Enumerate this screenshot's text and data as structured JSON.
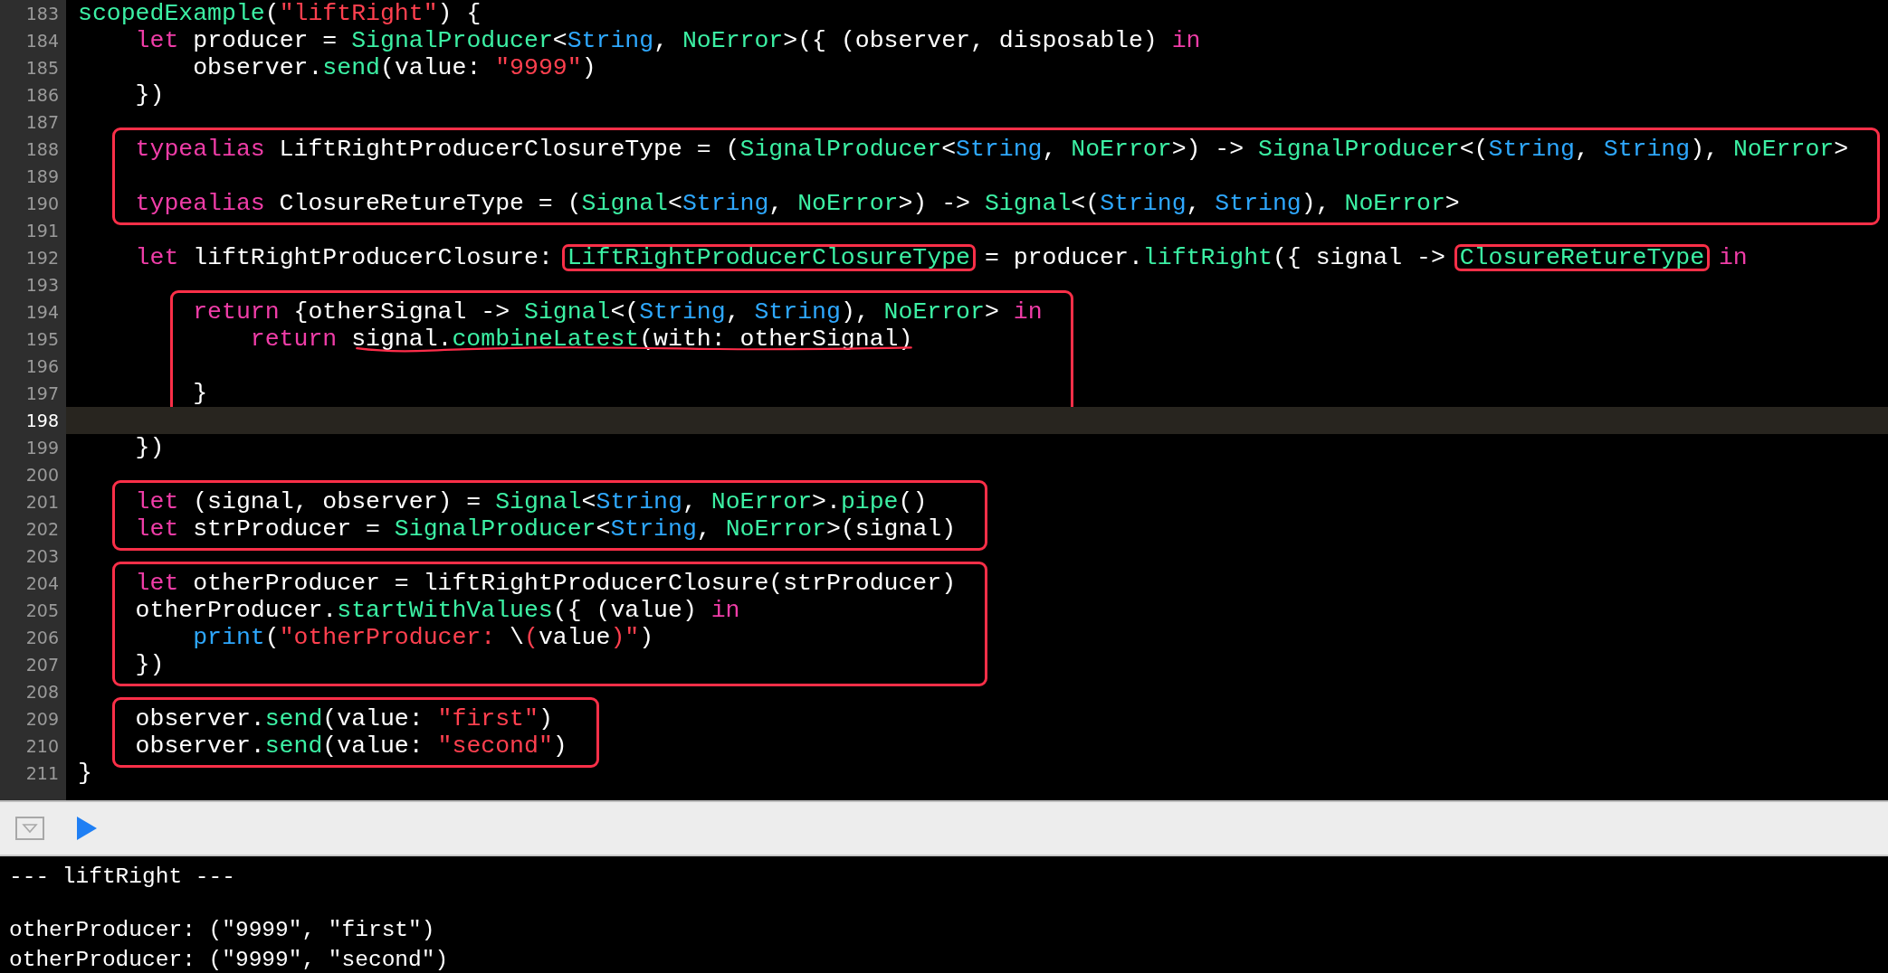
{
  "editor": {
    "blocks": [
      {
        "boxed": false,
        "lines": [
          {
            "n": "183",
            "current": false,
            "tokens": [
              {
                "text": "scopedExample",
                "kind": "type"
              },
              {
                "text": "(",
                "kind": "plain"
              },
              {
                "text": "\"liftRight\"",
                "kind": "string"
              },
              {
                "text": ") {",
                "kind": "plain"
              }
            ]
          },
          {
            "n": "184",
            "current": false,
            "tokens": [
              {
                "text": "    let",
                "kind": "keyword"
              },
              {
                "text": " producer = ",
                "kind": "plain"
              },
              {
                "text": "SignalProducer",
                "kind": "type"
              },
              {
                "text": "<",
                "kind": "plain"
              },
              {
                "text": "String",
                "kind": "builtin"
              },
              {
                "text": ", ",
                "kind": "plain"
              },
              {
                "text": "NoError",
                "kind": "type"
              },
              {
                "text": ">({ (observer, disposable) ",
                "kind": "plain"
              },
              {
                "text": "in",
                "kind": "keyword"
              }
            ]
          },
          {
            "n": "185",
            "current": false,
            "tokens": [
              {
                "text": "        observer.",
                "kind": "plain"
              },
              {
                "text": "send",
                "kind": "type"
              },
              {
                "text": "(value: ",
                "kind": "plain"
              },
              {
                "text": "\"9999\"",
                "kind": "string"
              },
              {
                "text": ")",
                "kind": "plain"
              }
            ]
          },
          {
            "n": "186",
            "current": false,
            "tokens": [
              {
                "text": "    })",
                "kind": "plain"
              }
            ]
          },
          {
            "n": "187",
            "current": false
          }
        ]
      },
      {
        "boxed": true,
        "lines": [
          {
            "n": "188",
            "current": false,
            "tokens": [
              {
                "text": "    typealias",
                "kind": "keyword"
              },
              {
                "text": " LiftRightProducerClosureType = (",
                "kind": "plain"
              },
              {
                "text": "SignalProducer",
                "kind": "type"
              },
              {
                "text": "<",
                "kind": "plain"
              },
              {
                "text": "String",
                "kind": "builtin"
              },
              {
                "text": ", ",
                "kind": "plain"
              },
              {
                "text": "NoError",
                "kind": "type"
              },
              {
                "text": ">) -> ",
                "kind": "plain"
              },
              {
                "text": "SignalProducer",
                "kind": "type"
              },
              {
                "text": "<(",
                "kind": "plain"
              },
              {
                "text": "String",
                "kind": "builtin"
              },
              {
                "text": ", ",
                "kind": "plain"
              },
              {
                "text": "String",
                "kind": "builtin"
              },
              {
                "text": "), ",
                "kind": "plain"
              },
              {
                "text": "NoError",
                "kind": "type"
              },
              {
                "text": ">",
                "kind": "plain"
              }
            ]
          },
          {
            "n": "189",
            "current": false
          },
          {
            "n": "190",
            "current": false,
            "tokens": [
              {
                "text": "    typealias",
                "kind": "keyword"
              },
              {
                "text": " ClosureRetureType = (",
                "kind": "plain"
              },
              {
                "text": "Signal",
                "kind": "type"
              },
              {
                "text": "<",
                "kind": "plain"
              },
              {
                "text": "String",
                "kind": "builtin"
              },
              {
                "text": ", ",
                "kind": "plain"
              },
              {
                "text": "NoError",
                "kind": "type"
              },
              {
                "text": ">) -> ",
                "kind": "plain"
              },
              {
                "text": "Signal",
                "kind": "type"
              },
              {
                "text": "<(",
                "kind": "plain"
              },
              {
                "text": "String",
                "kind": "builtin"
              },
              {
                "text": ", ",
                "kind": "plain"
              },
              {
                "text": "String",
                "kind": "builtin"
              },
              {
                "text": "), ",
                "kind": "plain"
              },
              {
                "text": "NoError",
                "kind": "type"
              },
              {
                "text": ">",
                "kind": "plain"
              }
            ]
          }
        ]
      },
      {
        "boxed": false,
        "lines": [
          {
            "n": "191",
            "current": false
          },
          {
            "n": "192",
            "current": false,
            "tokens": [
              {
                "text": "    let",
                "kind": "keyword"
              },
              {
                "text": " liftRightProducerClosure: ",
                "kind": "plain"
              },
              {
                "text": "LiftRightProducerClosureType",
                "kind": "type",
                "boxed": true
              },
              {
                "text": " = producer.",
                "kind": "plain"
              },
              {
                "text": "liftRight",
                "kind": "type"
              },
              {
                "text": "({ signal -> ",
                "kind": "plain"
              },
              {
                "text": "ClosureRetureType",
                "kind": "type",
                "boxed": true
              },
              {
                "text": " in",
                "kind": "keyword"
              }
            ]
          },
          {
            "n": "193",
            "current": false
          }
        ]
      },
      {
        "boxed": true,
        "lines": [
          {
            "n": "194",
            "current": false,
            "tokens": [
              {
                "text": "        return",
                "kind": "keyword"
              },
              {
                "text": " {otherSignal -> ",
                "kind": "plain"
              },
              {
                "text": "Signal",
                "kind": "type"
              },
              {
                "text": "<(",
                "kind": "plain"
              },
              {
                "text": "String",
                "kind": "builtin"
              },
              {
                "text": ", ",
                "kind": "plain"
              },
              {
                "text": "String",
                "kind": "builtin"
              },
              {
                "text": "), ",
                "kind": "plain"
              },
              {
                "text": "NoError",
                "kind": "type"
              },
              {
                "text": "> ",
                "kind": "plain"
              },
              {
                "text": "in",
                "kind": "keyword"
              }
            ]
          },
          {
            "n": "195",
            "current": false,
            "tokens": [
              {
                "text": "            return ",
                "kind": "keyword"
              },
              {
                "text": "signal.",
                "kind": "plain",
                "underlined": true
              },
              {
                "text": "combineLatest",
                "kind": "type",
                "underlined": true
              },
              {
                "text": "(with: otherSignal)",
                "kind": "plain",
                "underlined": true
              }
            ]
          },
          {
            "n": "196",
            "current": false
          },
          {
            "n": "197",
            "current": false,
            "tokens": [
              {
                "text": "        }",
                "kind": "plain"
              }
            ]
          }
        ]
      },
      {
        "boxed": false,
        "lines": [
          {
            "n": "198",
            "current": true
          },
          {
            "n": "199",
            "current": false,
            "tokens": [
              {
                "text": "    })",
                "kind": "plain"
              }
            ]
          },
          {
            "n": "200",
            "current": false
          }
        ]
      },
      {
        "boxed": true,
        "lines": [
          {
            "n": "201",
            "current": false,
            "tokens": [
              {
                "text": "    let",
                "kind": "keyword"
              },
              {
                "text": " (signal, observer) = ",
                "kind": "plain"
              },
              {
                "text": "Signal",
                "kind": "type"
              },
              {
                "text": "<",
                "kind": "plain"
              },
              {
                "text": "String",
                "kind": "builtin"
              },
              {
                "text": ", ",
                "kind": "plain"
              },
              {
                "text": "NoError",
                "kind": "type"
              },
              {
                "text": ">.",
                "kind": "plain"
              },
              {
                "text": "pipe",
                "kind": "type"
              },
              {
                "text": "()",
                "kind": "plain"
              }
            ]
          },
          {
            "n": "202",
            "current": false,
            "tokens": [
              {
                "text": "    let",
                "kind": "keyword"
              },
              {
                "text": " strProducer = ",
                "kind": "plain"
              },
              {
                "text": "SignalProducer",
                "kind": "type"
              },
              {
                "text": "<",
                "kind": "plain"
              },
              {
                "text": "String",
                "kind": "builtin"
              },
              {
                "text": ", ",
                "kind": "plain"
              },
              {
                "text": "NoError",
                "kind": "type"
              },
              {
                "text": ">(signal)",
                "kind": "plain"
              }
            ]
          }
        ]
      },
      {
        "boxed": false,
        "lines": [
          {
            "n": "203",
            "current": false
          }
        ]
      },
      {
        "boxed": true,
        "lines": [
          {
            "n": "204",
            "current": false,
            "tokens": [
              {
                "text": "    let",
                "kind": "keyword"
              },
              {
                "text": " otherProducer = liftRightProducerClosure(strProducer)",
                "kind": "plain"
              }
            ]
          },
          {
            "n": "205",
            "current": false,
            "tokens": [
              {
                "text": "    otherProducer.",
                "kind": "plain"
              },
              {
                "text": "startWithValues",
                "kind": "type"
              },
              {
                "text": "({ (value) ",
                "kind": "plain"
              },
              {
                "text": "in",
                "kind": "keyword"
              }
            ]
          },
          {
            "n": "206",
            "current": false,
            "tokens": [
              {
                "text": "        print",
                "kind": "builtin"
              },
              {
                "text": "(",
                "kind": "plain"
              },
              {
                "text": "\"otherProducer: ",
                "kind": "string"
              },
              {
                "text": "\\",
                "kind": "plain"
              },
              {
                "text": "(",
                "kind": "string"
              },
              {
                "text": "value",
                "kind": "plain"
              },
              {
                "text": ")\"",
                "kind": "string"
              },
              {
                "text": ")",
                "kind": "plain"
              }
            ]
          },
          {
            "n": "207",
            "current": false,
            "tokens": [
              {
                "text": "    })",
                "kind": "plain"
              }
            ]
          }
        ]
      },
      {
        "boxed": false,
        "lines": [
          {
            "n": "208",
            "current": false
          }
        ]
      },
      {
        "boxed": true,
        "lines": [
          {
            "n": "209",
            "current": false,
            "tokens": [
              {
                "text": "    observer.",
                "kind": "plain"
              },
              {
                "text": "send",
                "kind": "type"
              },
              {
                "text": "(value: ",
                "kind": "plain"
              },
              {
                "text": "\"first\"",
                "kind": "string"
              },
              {
                "text": ")",
                "kind": "plain"
              }
            ]
          },
          {
            "n": "210",
            "current": false,
            "tokens": [
              {
                "text": "    observer.",
                "kind": "plain"
              },
              {
                "text": "send",
                "kind": "type"
              },
              {
                "text": "(value: ",
                "kind": "plain"
              },
              {
                "text": "\"second\"",
                "kind": "string"
              },
              {
                "text": ")",
                "kind": "plain"
              }
            ]
          }
        ]
      },
      {
        "boxed": false,
        "lines": [
          {
            "n": "211",
            "current": false,
            "tokens": [
              {
                "text": "}",
                "kind": "plain"
              }
            ]
          }
        ]
      }
    ]
  },
  "console": {
    "output_groups": [
      [
        "--- liftRight ---"
      ],
      [
        "otherProducer: (\"9999\", \"first\")",
        "otherProducer: (\"9999\", \"second\")"
      ]
    ]
  }
}
